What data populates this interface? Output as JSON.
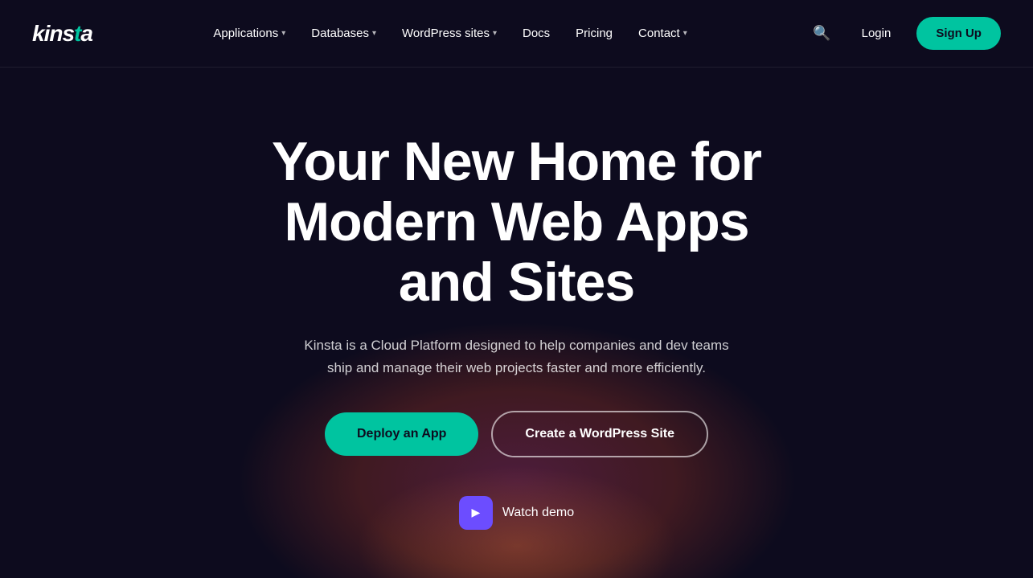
{
  "nav": {
    "logo": "kinsta",
    "links": [
      {
        "label": "Applications",
        "has_dropdown": true
      },
      {
        "label": "Databases",
        "has_dropdown": true
      },
      {
        "label": "WordPress sites",
        "has_dropdown": true
      },
      {
        "label": "Docs",
        "has_dropdown": false
      },
      {
        "label": "Pricing",
        "has_dropdown": false
      },
      {
        "label": "Contact",
        "has_dropdown": true
      }
    ],
    "login_label": "Login",
    "signup_label": "Sign Up"
  },
  "hero": {
    "title": "Your New Home for Modern Web Apps and Sites",
    "subtitle": "Kinsta is a Cloud Platform designed to help companies and dev teams ship and manage their web projects faster and more efficiently.",
    "btn_deploy": "Deploy an App",
    "btn_wordpress": "Create a WordPress Site",
    "watch_demo": "Watch demo"
  }
}
